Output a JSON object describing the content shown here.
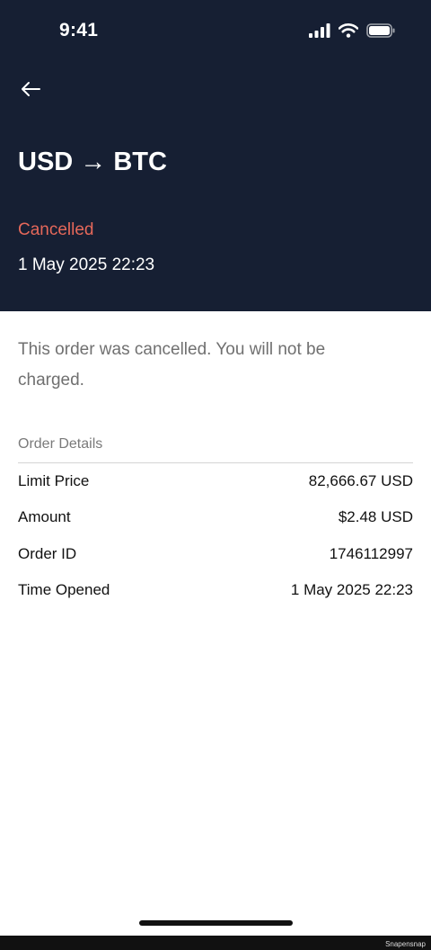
{
  "status_bar": {
    "time": "9:41",
    "icons": [
      "signal-icon",
      "wifi-icon",
      "battery-icon"
    ]
  },
  "header": {
    "back_icon": "arrow-left-icon",
    "title": "USD → BTC",
    "status": "Cancelled",
    "date": "1 May 2025 22:23",
    "background_color": "#161f33",
    "status_color": "#e5685a"
  },
  "notice": "This order was cancelled. You will not be charged.",
  "order_details": {
    "section_label": "Order Details",
    "rows": [
      {
        "label": "Limit Price",
        "value": "82,666.67 USD"
      },
      {
        "label": "Amount",
        "value": "$2.48 USD"
      },
      {
        "label": "Order ID",
        "value": "1746112997"
      },
      {
        "label": "Time Opened",
        "value": "1 May 2025 22:23"
      }
    ]
  },
  "watermark": "Snapensnap"
}
